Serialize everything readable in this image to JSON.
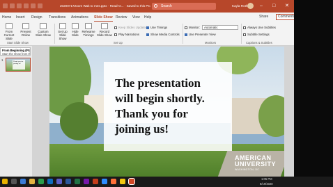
{
  "titlebar": {
    "file_title": "20200717Zoom Wait to mes.pptx · Read-O... · Saved to this PC",
    "search_placeholder": "Search",
    "user_name": "Kayla Roth",
    "win_minimize": "–",
    "win_restore": "□",
    "win_close": "✕",
    "color": "#b7472a"
  },
  "tabs": [
    "Home",
    "Insert",
    "Design",
    "Transitions",
    "Animations",
    "Slide Show",
    "Review",
    "View",
    "Help"
  ],
  "active_tab": "Slide Show",
  "share_label": "Share",
  "comments_label": "Comments",
  "ribbon": {
    "from_beginning": "From Beginning",
    "from_current": "From Current Slide",
    "present_online": "Present Online",
    "custom_show": "Custom Slide Show",
    "set_up": "Set Up Slide Show",
    "hide_slide": "Hide Slide",
    "rehearse": "Rehearse Timings",
    "record": "Record Slide Show",
    "keep_updated": "Keep Slides Updated",
    "play_narrations": "Play Narrations",
    "use_timings": "Use Timings",
    "show_media_controls": "Show Media Controls",
    "monitor_label": "Monitor:",
    "monitor_value": "Automatic",
    "use_presenter_view": "Use Presenter View",
    "always_subtitles": "Always Use Subtitles",
    "subtitle_settings": "Subtitle Settings",
    "group_start": "Start Slide Show",
    "group_setup": "Set Up",
    "group_monitors": "Monitors",
    "group_captions": "Captions & Subtitles"
  },
  "tooltip": {
    "title": "From Beginning (F5)",
    "desc": "Start the show from the first slide."
  },
  "thumbnail": {
    "number": "1",
    "text": "Thank you for joining us!"
  },
  "slide": {
    "line1": "The presentation",
    "line2": "will begin shortly.",
    "line3": "Thank you for",
    "line4": "joining us!",
    "logo_line1": "AMERICAN",
    "logo_line2": "UNIVERSITY",
    "logo_sub": "WASHINGTON, DC"
  },
  "taskbar": {
    "time": "1:05 PM",
    "date": "8/19/2020",
    "icons": [
      "windows-icon",
      "search-icon",
      "task-view-icon",
      "edge-icon",
      "explorer-icon",
      "chrome-icon",
      "outlook-icon",
      "teams-icon",
      "word-icon",
      "excel-icon",
      "onenote-icon",
      "powerpoint-icon",
      "zoom-icon",
      "firefox-icon",
      "notes-icon",
      "powerpoint-active-icon"
    ]
  }
}
